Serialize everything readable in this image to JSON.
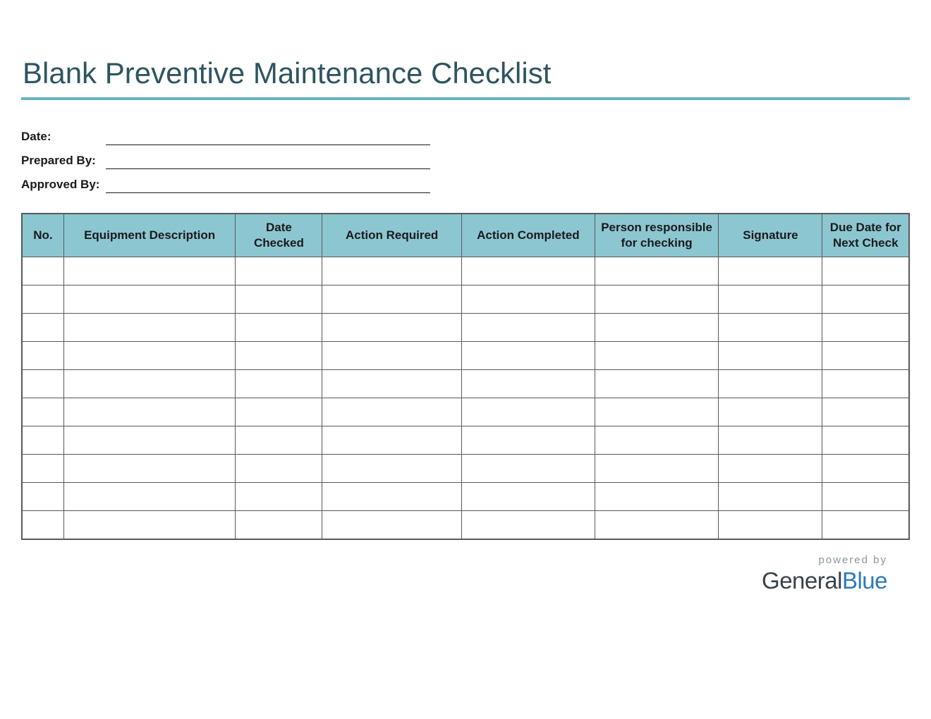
{
  "title": "Blank Preventive Maintenance Checklist",
  "meta": {
    "date_label": "Date:",
    "date_value": "",
    "prepared_by_label": "Prepared By:",
    "prepared_by_value": "",
    "approved_by_label": "Approved By:",
    "approved_by_value": ""
  },
  "table": {
    "headers": {
      "no": "No.",
      "equipment_description": "Equipment Description",
      "date_checked": "Date Checked",
      "action_required": "Action Required",
      "action_completed": "Action Completed",
      "person_responsible": "Person responsible for checking",
      "signature": "Signature",
      "due_date": "Due Date for Next Check"
    },
    "rows": [
      {
        "no": "",
        "equipment_description": "",
        "date_checked": "",
        "action_required": "",
        "action_completed": "",
        "person_responsible": "",
        "signature": "",
        "due_date": ""
      },
      {
        "no": "",
        "equipment_description": "",
        "date_checked": "",
        "action_required": "",
        "action_completed": "",
        "person_responsible": "",
        "signature": "",
        "due_date": ""
      },
      {
        "no": "",
        "equipment_description": "",
        "date_checked": "",
        "action_required": "",
        "action_completed": "",
        "person_responsible": "",
        "signature": "",
        "due_date": ""
      },
      {
        "no": "",
        "equipment_description": "",
        "date_checked": "",
        "action_required": "",
        "action_completed": "",
        "person_responsible": "",
        "signature": "",
        "due_date": ""
      },
      {
        "no": "",
        "equipment_description": "",
        "date_checked": "",
        "action_required": "",
        "action_completed": "",
        "person_responsible": "",
        "signature": "",
        "due_date": ""
      },
      {
        "no": "",
        "equipment_description": "",
        "date_checked": "",
        "action_required": "",
        "action_completed": "",
        "person_responsible": "",
        "signature": "",
        "due_date": ""
      },
      {
        "no": "",
        "equipment_description": "",
        "date_checked": "",
        "action_required": "",
        "action_completed": "",
        "person_responsible": "",
        "signature": "",
        "due_date": ""
      },
      {
        "no": "",
        "equipment_description": "",
        "date_checked": "",
        "action_required": "",
        "action_completed": "",
        "person_responsible": "",
        "signature": "",
        "due_date": ""
      },
      {
        "no": "",
        "equipment_description": "",
        "date_checked": "",
        "action_required": "",
        "action_completed": "",
        "person_responsible": "",
        "signature": "",
        "due_date": ""
      },
      {
        "no": "",
        "equipment_description": "",
        "date_checked": "",
        "action_required": "",
        "action_completed": "",
        "person_responsible": "",
        "signature": "",
        "due_date": ""
      }
    ]
  },
  "footer": {
    "powered_by": "powered by",
    "brand_general": "General",
    "brand_blue": "Blue"
  },
  "colors": {
    "accent": "#6ab2c0",
    "header_bg": "#8cc6d1",
    "title_color": "#2e5560",
    "border": "#58595b",
    "brand_blue": "#2b7bb9"
  }
}
